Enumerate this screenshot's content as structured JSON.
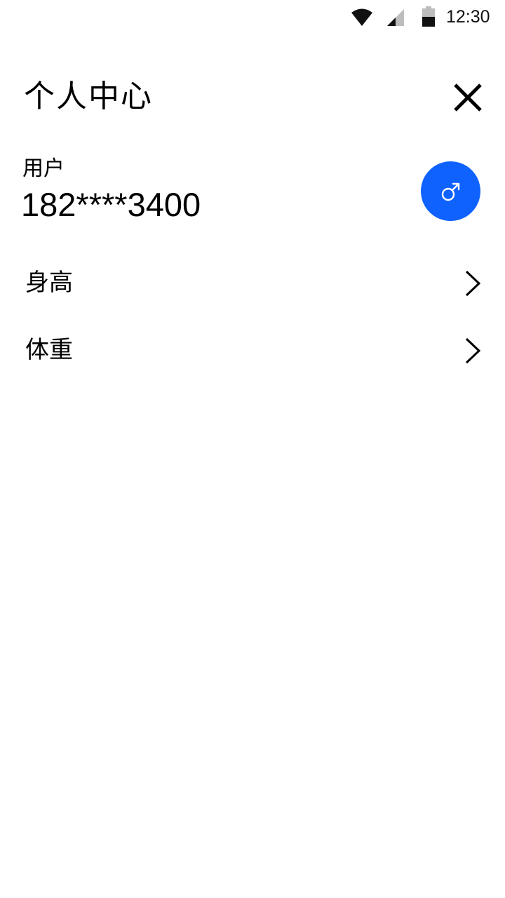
{
  "status_bar": {
    "time": "12:30",
    "icons": [
      "wifi-icon",
      "cell-signal-icon",
      "battery-icon"
    ]
  },
  "header": {
    "title": "个人中心",
    "close_icon": "close-icon"
  },
  "user": {
    "label": "用户",
    "phone": "182****3400",
    "avatar_icon": "male-symbol-icon",
    "avatar_color": "#0f62fe"
  },
  "list": {
    "items": [
      {
        "label": "身高",
        "icon": "chevron-right-icon"
      },
      {
        "label": "体重",
        "icon": "chevron-right-icon"
      }
    ]
  }
}
